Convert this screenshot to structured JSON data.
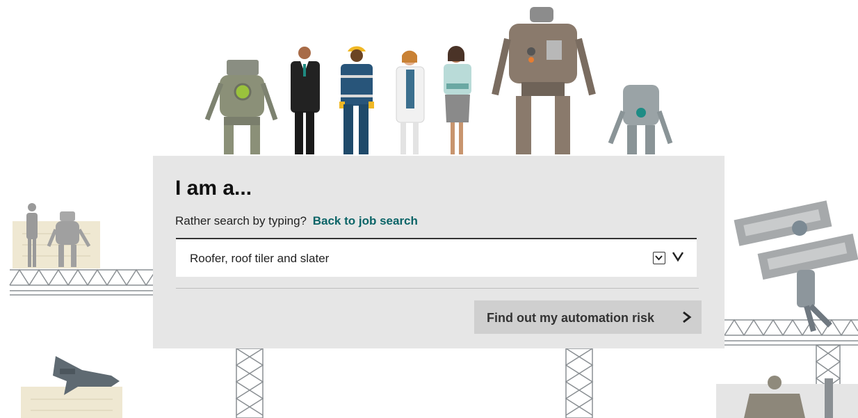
{
  "heading": "I am a...",
  "search_prompt": "Rather search by typing?",
  "back_link": "Back to job search",
  "occupation_select": {
    "selected": "Roofer, roof tiler and slater"
  },
  "cta_label": "Find out my automation risk",
  "colors": {
    "panel": "#e6e6e6",
    "link": "#0b6467",
    "button": "#cfcfcf"
  },
  "icons": [
    "checkbox-icon",
    "chevron-down-icon",
    "chevron-right-icon"
  ]
}
